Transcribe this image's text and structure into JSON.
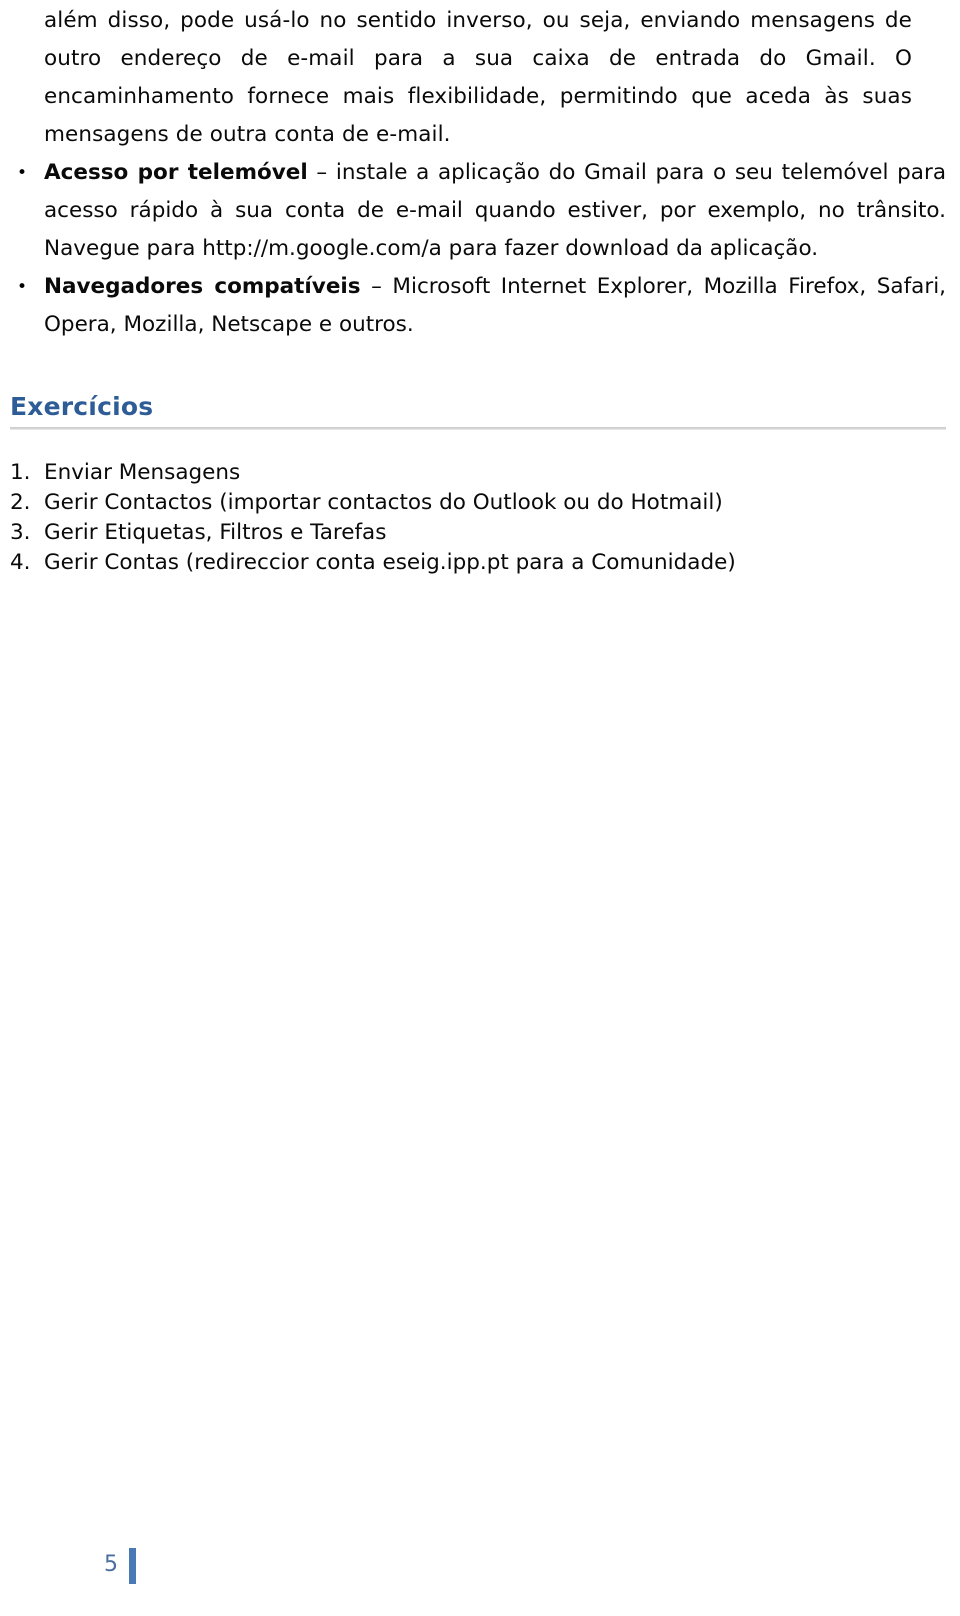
{
  "document": {
    "language": "pt-PT",
    "paragraphs": [
      {
        "id": "continuation",
        "text": "além disso, pode usá-lo no sentido inverso, ou seja, enviando mensagens de outro endereço de e-mail para a sua caixa de entrada do Gmail. O encaminhamento fornece mais flexibilidade, permitindo que aceda às suas mensagens de outra conta de e-mail."
      }
    ],
    "bullets": [
      {
        "glyph": "•",
        "lead": "Acesso por telemóvel",
        "separator": " – ",
        "text": "instale a aplicação do Gmail para o seu telemóvel para acesso rápido à sua conta de e-mail quando estiver, por exemplo, no trânsito. Navegue para http://m.google.com/a para fazer download da aplicação."
      },
      {
        "glyph": "•",
        "lead": "Navegadores compatíveis",
        "separator": " – ",
        "text": "Microsoft Internet Explorer, Mozilla Firefox, Safari, Opera, Mozilla, Netscape e outros."
      }
    ],
    "heading": {
      "title": "Exercícios",
      "color": "#2E5C96"
    },
    "exercises": [
      {
        "marker": "1.",
        "text": "Enviar Mensagens"
      },
      {
        "marker": "2.",
        "text": "Gerir Contactos (importar contactos do Outlook ou do Hotmail)"
      },
      {
        "marker": "3.",
        "text": "Gerir Etiquetas, Filtros e Tarefas"
      },
      {
        "marker": "4.",
        "text": "Gerir Contas (redireccior conta eseig.ipp.pt para a Comunidade)"
      }
    ],
    "footer": {
      "page_number": "5",
      "bar_color": "#4a7ab5"
    }
  }
}
